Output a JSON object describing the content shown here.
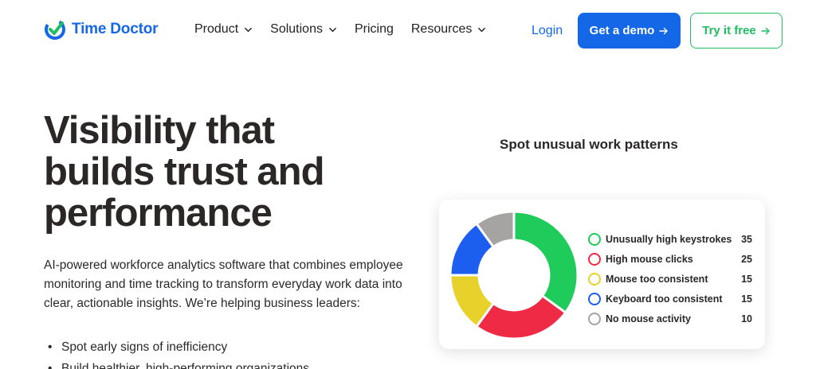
{
  "brand": {
    "name": "Time Doctor",
    "blue": "#1467e6",
    "green": "#1fbe63"
  },
  "nav": {
    "items": [
      {
        "label": "Product",
        "has_dropdown": true
      },
      {
        "label": "Solutions",
        "has_dropdown": true
      },
      {
        "label": "Pricing",
        "has_dropdown": false
      },
      {
        "label": "Resources",
        "has_dropdown": true
      }
    ],
    "login": "Login",
    "demo": "Get a demo",
    "try": "Try it free",
    "arrow_icon": "arrow-right-icon"
  },
  "hero": {
    "title": "Visibility that builds trust and performance",
    "description": "AI-powered workforce analytics software that combines employee monitoring and time tracking to transform everyday work data into clear, actionable insights. We’re helping business leaders:",
    "bullets": [
      "Spot early signs of inefficiency",
      "Build healthier, high-performing organizations"
    ]
  },
  "card": {
    "heading": "Spot unusual work patterns"
  },
  "chart_data": {
    "type": "pie",
    "donut": true,
    "series": [
      {
        "name": "Unusually high keystrokes",
        "value": 35,
        "color": "#1ecb5b"
      },
      {
        "name": "High mouse clicks",
        "value": 25,
        "color": "#ee2a45"
      },
      {
        "name": "Mouse too consistent",
        "value": 15,
        "color": "#e9d12b"
      },
      {
        "name": "Keyboard too consistent",
        "value": 15,
        "color": "#1c5ef0"
      },
      {
        "name": "No mouse activity",
        "value": 10,
        "color": "#a6a4a3"
      }
    ],
    "legend_placement": "right"
  }
}
